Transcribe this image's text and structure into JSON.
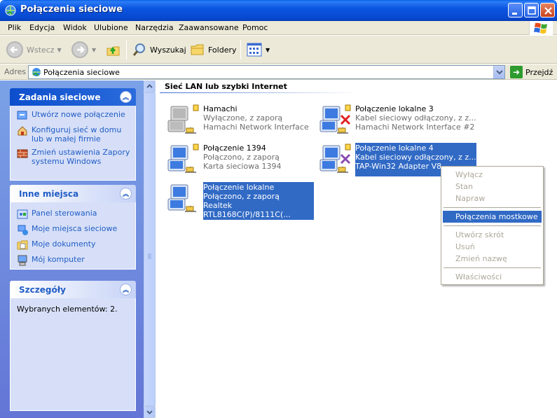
{
  "window": {
    "title": "Połączenia sieciowe"
  },
  "menu": [
    "Plik",
    "Edycja",
    "Widok",
    "Ulubione",
    "Narzędzia",
    "Zaawansowane",
    "Pomoc"
  ],
  "toolbar": {
    "back": "Wstecz",
    "search": "Wyszukaj",
    "folders": "Foldery"
  },
  "address": {
    "label": "Adres",
    "value": "Połączenia sieciowe",
    "go": "Przejdź"
  },
  "left_pane": {
    "network_tasks": {
      "title": "Zadania sieciowe",
      "items": [
        {
          "label": "Utwórz nowe połączenie",
          "icon": "new-connection-icon"
        },
        {
          "label": "Konfiguruj sieć w domu lub w małej firmie",
          "icon": "home-network-icon"
        },
        {
          "label": "Zmień ustawienia Zapory systemu Windows",
          "icon": "firewall-icon"
        }
      ]
    },
    "other_places": {
      "title": "Inne miejsca",
      "items": [
        {
          "label": "Panel sterowania",
          "icon": "control-panel-icon"
        },
        {
          "label": "Moje miejsca sieciowe",
          "icon": "network-places-icon"
        },
        {
          "label": "Moje dokumenty",
          "icon": "documents-icon"
        },
        {
          "label": "Mój komputer",
          "icon": "computer-icon"
        }
      ]
    },
    "details": {
      "title": "Szczegóły",
      "text": "Wybranych elementów: 2."
    }
  },
  "content": {
    "group_header": "Sieć LAN lub szybki Internet",
    "connections": [
      {
        "name": "Hamachi",
        "status": "Wyłączone, z zaporą",
        "device": "Hamachi Network Interface",
        "state": "disabled",
        "selected": false
      },
      {
        "name": "Połączenie lokalne 3",
        "status": "Kabel sieciowy odłączony, z z...",
        "device": "Hamachi Network Interface #2",
        "state": "unplugged",
        "selected": false
      },
      {
        "name": "Połączenie 1394",
        "status": "Połączono, z zaporą",
        "device": "Karta sieciowa 1394",
        "state": "connected",
        "selected": false
      },
      {
        "name": "Połączenie lokalne 4",
        "status": "Kabel sieciowy odłączony, z z...",
        "device": "TAP-Win32 Adapter V8",
        "state": "unplugged",
        "selected": true
      },
      {
        "name": "Połączenie lokalne",
        "status": "Połączono, z zaporą",
        "device": "Realtek RTL8168C(P)/8111C(...",
        "state": "connected",
        "selected": true
      }
    ]
  },
  "context_menu": {
    "items": [
      {
        "label": "Wyłącz",
        "enabled": false
      },
      {
        "label": "Stan",
        "enabled": false
      },
      {
        "label": "Napraw",
        "enabled": false
      },
      {
        "label": "Połączenia mostkowe",
        "enabled": true,
        "highlighted": true
      },
      {
        "label": "Utwórz skrót",
        "enabled": false
      },
      {
        "label": "Usuń",
        "enabled": false
      },
      {
        "label": "Zmień nazwę",
        "enabled": false
      },
      {
        "label": "Właściwości",
        "enabled": false
      }
    ]
  }
}
